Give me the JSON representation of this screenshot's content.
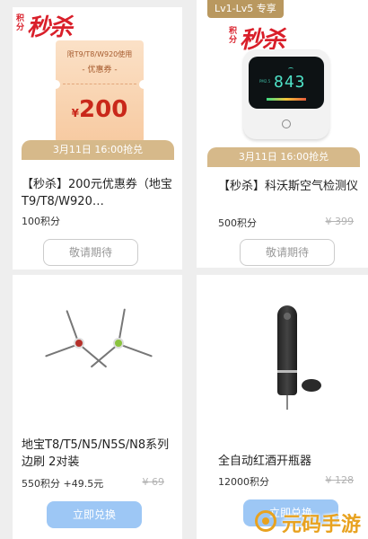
{
  "badges": {
    "miaosha_small": "积分",
    "miaosha_big": "秒杀",
    "vip": "Lv1-Lv5 专享"
  },
  "coupon": {
    "usage": "限T9/T8/W920使用",
    "name": "- 优惠券 -",
    "currency": "¥",
    "amount": "200"
  },
  "monitor": {
    "reading": "843",
    "label": "PM2.5"
  },
  "products": [
    {
      "date": "3月11日 16:00抢兑",
      "title": "【秒杀】200元优惠券（地宝T9/T8/W920…",
      "points": "100积分",
      "button": "敬请期待"
    },
    {
      "date": "3月11日 16:00抢兑",
      "title": "【秒杀】科沃斯空气检测仪",
      "points": "500积分",
      "original": "¥ 399",
      "button": "敬请期待"
    },
    {
      "title": "地宝T8/T5/N5/N5S/N8系列边刷 2对装",
      "points": "550积分 +49.5元",
      "original": "¥ 69",
      "button": "立即兑换"
    },
    {
      "title": "全自动红酒开瓶器",
      "points": "12000积分",
      "original": "¥ 128",
      "button": "立即兑换"
    }
  ],
  "watermark": "元码手游网",
  "colors": {
    "gold": "#d6b98a",
    "red": "#d91f2a",
    "button_blue": "#9dc7f5"
  }
}
